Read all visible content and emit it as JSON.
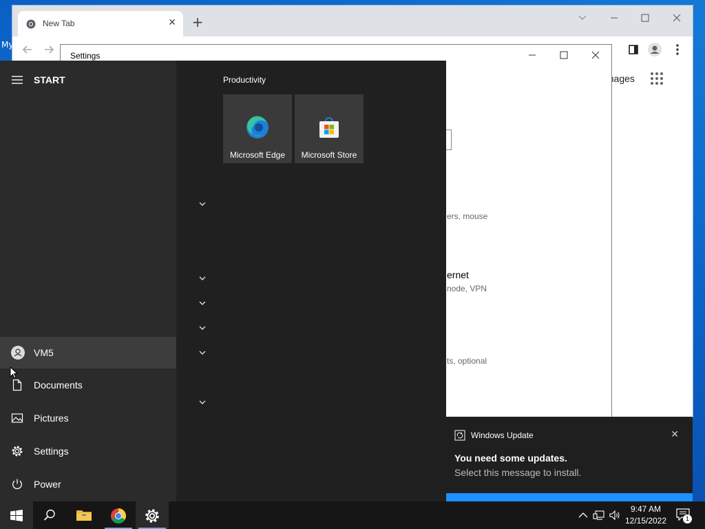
{
  "desktop": {
    "label": "My"
  },
  "chrome": {
    "tab_title": "New Tab",
    "tab_close": "✕",
    "new_tab": "+",
    "images_link": "Images"
  },
  "settings": {
    "title": "Settings",
    "frag_devices": "ers, mouse",
    "frag_network_title": "ernet",
    "frag_network_sub": "node, VPN",
    "frag_apps": "ts, optional"
  },
  "start": {
    "title": "START",
    "user": "VM5",
    "items": [
      {
        "label": "Documents",
        "icon": "document-icon"
      },
      {
        "label": "Pictures",
        "icon": "pictures-icon"
      },
      {
        "label": "Settings",
        "icon": "gear-icon"
      },
      {
        "label": "Power",
        "icon": "power-icon"
      }
    ],
    "group_title": "Productivity",
    "tiles": [
      {
        "label": "Microsoft Edge",
        "icon": "edge-icon"
      },
      {
        "label": "Microsoft Store",
        "icon": "store-icon"
      }
    ]
  },
  "toast": {
    "app": "Windows Update",
    "heading": "You need some updates.",
    "message": "Select this message to install.",
    "close": "✕"
  },
  "taskbar": {
    "time": "9:47 AM",
    "date": "12/15/2022",
    "notification_count": "1"
  },
  "colors": {
    "start_bg": "#202020",
    "start_left_bg": "#2b2b2b",
    "tile_bg": "#3a3a3a",
    "desktop_blue": "#0a5fc4",
    "taskbar_bg": "#161616"
  }
}
